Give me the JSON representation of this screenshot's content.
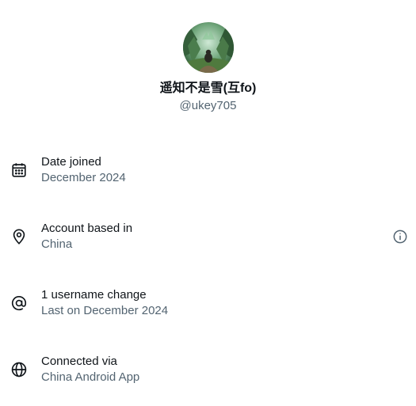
{
  "profile": {
    "display_name": "遥知不是雪(互fo)",
    "handle": "@ukey705"
  },
  "about": {
    "date_joined": {
      "label": "Date joined",
      "value": "December 2024",
      "icon": "calendar-icon"
    },
    "account_based_in": {
      "label": "Account based in",
      "value": "China",
      "icon": "location-pin-icon",
      "info_icon": "info-icon"
    },
    "username_changes": {
      "label": "1 username change",
      "value": "Last on December 2024",
      "icon": "at-sign-icon"
    },
    "connected_via": {
      "label": "Connected via",
      "value": "China Android App",
      "icon": "globe-icon"
    }
  },
  "colors": {
    "primary_text": "#0f1419",
    "secondary_text": "#536471",
    "background": "#ffffff"
  }
}
